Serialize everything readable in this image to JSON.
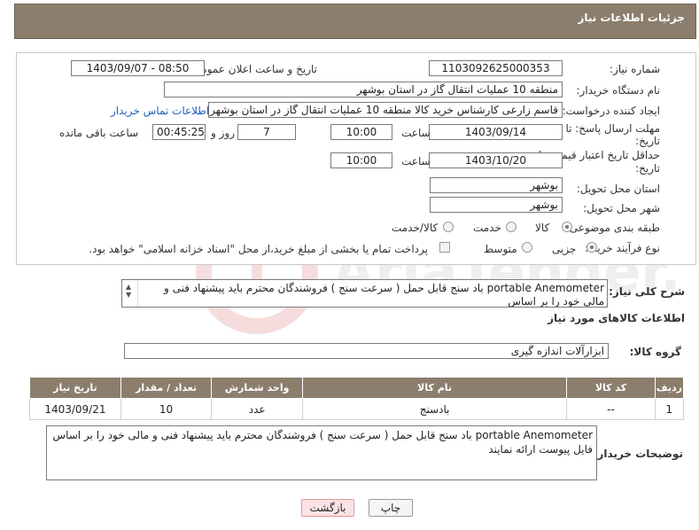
{
  "header": {
    "title": "جزئیات اطلاعات نیاز"
  },
  "form": {
    "need_number_label": "شماره نیاز:",
    "need_number": "1103092625000353",
    "announce_label": "تاریخ و ساعت اعلان عمومی:",
    "announce_value": "1403/09/07 - 08:50",
    "buyer_org_label": "نام دستگاه خریدار:",
    "buyer_org": "منطقه 10 عملیات انتقال گاز در استان بوشهر",
    "creator_label": "ایجاد کننده درخواست:",
    "creator": "قاسم زارعی کارشناس خرید کالا منطقه 10 عملیات انتقال گاز در استان بوشهر",
    "contact_link": "اطلاعات تماس خریدار",
    "deadline_label_1": "مهلت ارسال پاسخ: تا",
    "deadline_label_2": "تاریخ:",
    "deadline_date": "1403/09/14",
    "time_label": "ساعت",
    "deadline_time": "10:00",
    "days_value": "7",
    "days_label": "روز و",
    "remaining_value": "00:45:25",
    "remaining_label": "ساعت باقی مانده",
    "validity_label_1": "حداقل تاریخ اعتبار قیمت: تا",
    "validity_label_2": "تاریخ:",
    "validity_date": "1403/10/20",
    "validity_time": "10:00",
    "province_label": "استان محل تحویل:",
    "province": "بوشهر",
    "city_label": "شهر محل تحویل:",
    "city": "بوشهر",
    "category_label": "طبقه بندی موضوعی:",
    "category_options": [
      "کالا",
      "خدمت",
      "کالا/خدمت"
    ],
    "process_label": "نوع فرآیند خرید :",
    "process_options": [
      "جزیی",
      "متوسط"
    ],
    "payment_note": "پرداخت تمام یا بخشی از مبلغ خرید،از محل \"اسناد خزانه اسلامی\" خواهد بود."
  },
  "summary": {
    "label": "شرح کلی نیاز:",
    "text": "portable Anemometer باد سنج قابل حمل ( سرعت سنج ) فروشندگان محترم باید پیشنهاد فنی و مالی خود را بر اساس"
  },
  "goods": {
    "section_title": "اطلاعات کالاهای مورد نیاز",
    "group_label": "گروه کالا:",
    "group_value": "ابزارآلات اندازه گیری",
    "columns": [
      "ردیف",
      "کد کالا",
      "نام کالا",
      "واحد شمارش",
      "تعداد / مقدار",
      "تاریخ نیاز"
    ],
    "rows": [
      {
        "row": "1",
        "code": "--",
        "name": "بادسنج",
        "unit": "عدد",
        "qty": "10",
        "date": "1403/09/21"
      }
    ]
  },
  "buyer_notes": {
    "label": "توضیحات خریدار:",
    "text": "portable Anemometer باد سنج قابل حمل ( سرعت سنج ) فروشندگان محترم باید پیشنهاد فنی و مالی خود را بر اساس فایل پیوست ارائه نمایند"
  },
  "buttons": {
    "print": "چاپ",
    "back": "بازگشت"
  },
  "watermark": {
    "text": "AriaTender.neT"
  }
}
